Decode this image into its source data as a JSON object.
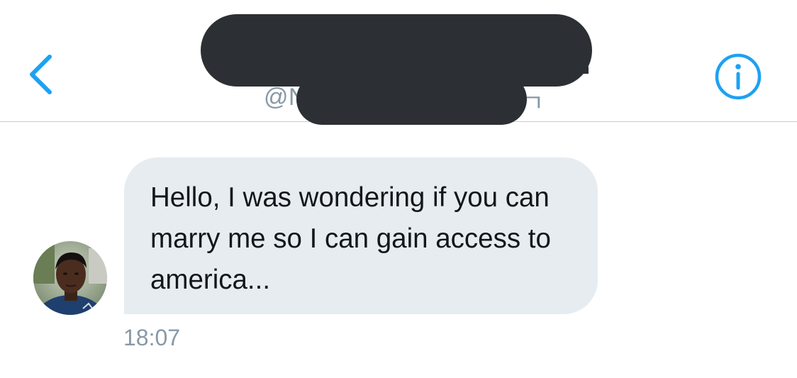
{
  "header": {
    "back_icon": "chevron-left-icon",
    "info_icon": "info-circle-icon",
    "handle_visible_prefix": "@N",
    "handle_visible_suffix": "ㄱ",
    "accent_color": "#1da1f2"
  },
  "conversation": {
    "messages": [
      {
        "text": "Hello, I was wondering if you can marry me so I can gain access to america...",
        "time": "18:07",
        "direction": "incoming",
        "bubble_color": "#e6ecf0"
      }
    ]
  }
}
